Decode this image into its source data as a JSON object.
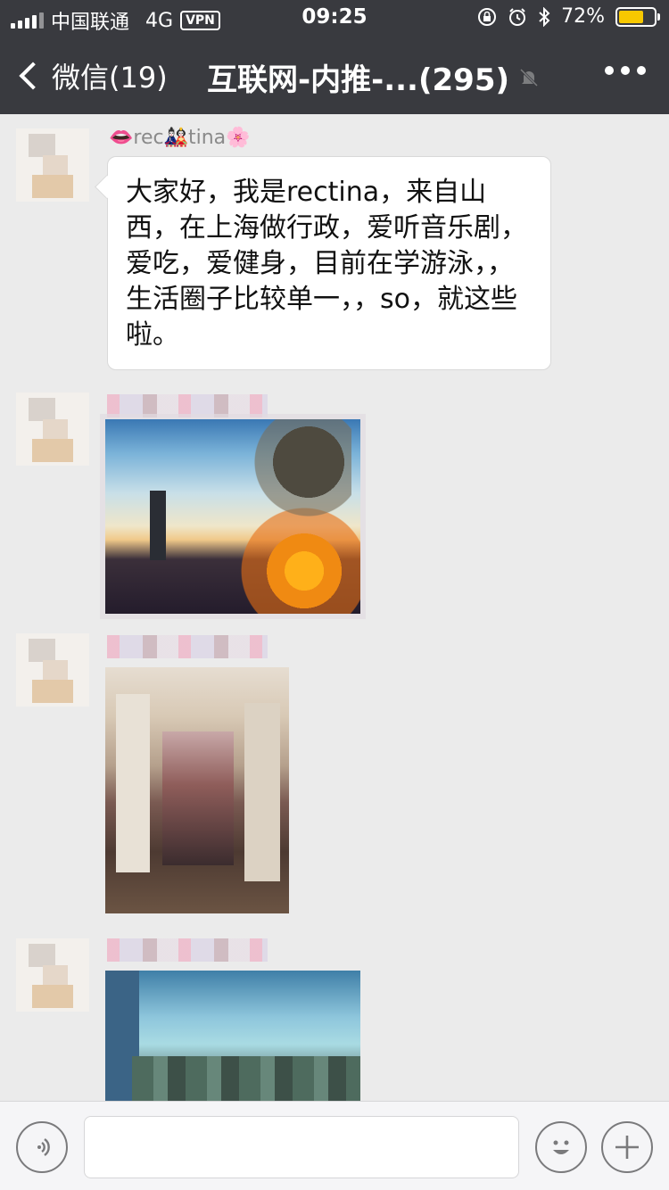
{
  "status_bar": {
    "carrier": "中国联通",
    "network": "4G",
    "vpn": "VPN",
    "time": "09:25",
    "battery_percent": "72%",
    "battery_level": 0.72,
    "colors": {
      "battery_fill": "#f7c800"
    }
  },
  "nav": {
    "back_label": "微信(19)",
    "title": "互联网-内推-...(295)",
    "icons": [
      "chevron-left-icon",
      "mute-bell-icon",
      "more-dots-icon"
    ]
  },
  "messages": [
    {
      "sender": "👄rec🎎tina🌸",
      "text": "大家好，我是rectina，来自山西，在上海做行政，爱听音乐剧，爱吃，爱健身，目前在学游泳，，生活圈子比较单一，，so，就这些啦。"
    },
    {
      "type": "image",
      "description_icon": "photo-sunset"
    },
    {
      "type": "image",
      "description_icon": "photo-room"
    },
    {
      "type": "image",
      "description_icon": "photo-sky"
    }
  ],
  "input_bar": {
    "icons": [
      "voice-icon",
      "emoji-icon",
      "plus-icon"
    ],
    "text_value": ""
  },
  "colors": {
    "nav_bg": "#393a3f",
    "chat_bg": "#ebebeb",
    "bubble_bg": "#ffffff"
  }
}
